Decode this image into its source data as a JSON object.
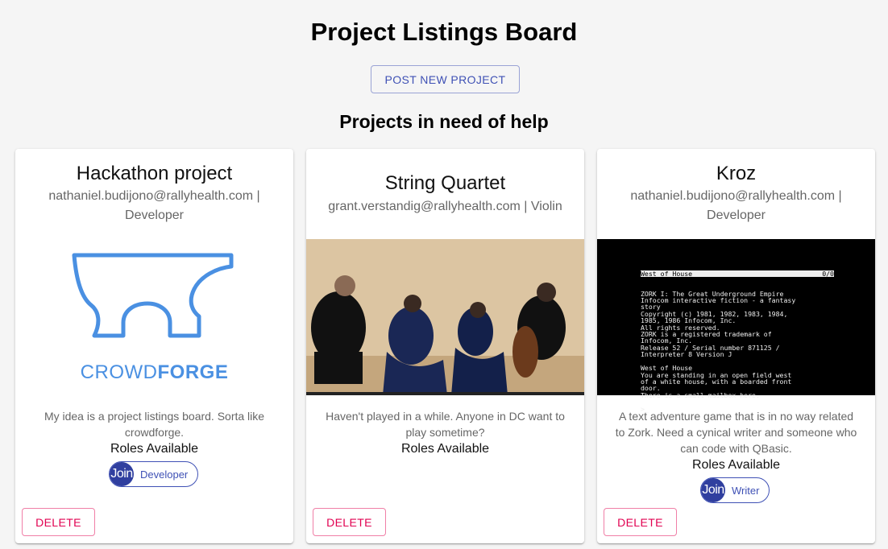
{
  "header": {
    "title": "Project Listings Board",
    "post_button": "POST NEW PROJECT",
    "section_title": "Projects in need of help"
  },
  "projects": [
    {
      "title": "Hackathon project",
      "contact": "nathaniel.budijono@rallyhealth.com | Developer",
      "media": {
        "type": "logo",
        "brand_light": "CROWD",
        "brand_bold": "FORGE",
        "color": "#4a90e2"
      },
      "description": "My idea is a project listings board. Sorta like crowdforge.",
      "roles_label": "Roles Available",
      "roles": [
        {
          "join": "Join",
          "name": "Developer"
        }
      ],
      "delete": "DELETE"
    },
    {
      "title": "String Quartet",
      "contact": "grant.verstandig@rallyhealth.com | Violin",
      "media": {
        "type": "photo"
      },
      "description": "Haven't played in a while. Anyone in DC want to play sometime?",
      "roles_label": "Roles Available",
      "roles": [],
      "delete": "DELETE"
    },
    {
      "title": "Kroz",
      "contact": "nathaniel.budijono@rallyhealth.com | Developer",
      "media": {
        "type": "terminal",
        "status_left": "West of House",
        "status_right": "0/0",
        "lines": [
          "ZORK I: The Great Underground Empire",
          "Infocom interactive fiction - a fantasy",
          "story",
          "Copyright (c) 1981, 1982, 1983, 1984,",
          "1985, 1986 Infocom, Inc.",
          "All rights reserved.",
          "ZORK is a registered trademark of",
          "Infocom, Inc.",
          "Release 52 / Serial number 871125 /",
          "Interpreter 8 Version J",
          "",
          "West of House",
          "You are standing in an open field west",
          "of a white house, with a boarded front",
          "door.",
          "There is a small mailbox here.",
          "",
          ">_"
        ]
      },
      "description": "A text adventure game that is in no way related to Zork. Need a cynical writer and someone who can code with QBasic.",
      "roles_label": "Roles Available",
      "roles": [
        {
          "join": "Join",
          "name": "Writer"
        }
      ],
      "delete": "DELETE"
    }
  ],
  "colors": {
    "primary": "#3f51b5",
    "primary_dark": "#303f9f",
    "secondary": "#e10050",
    "logo": "#4a90e2"
  }
}
